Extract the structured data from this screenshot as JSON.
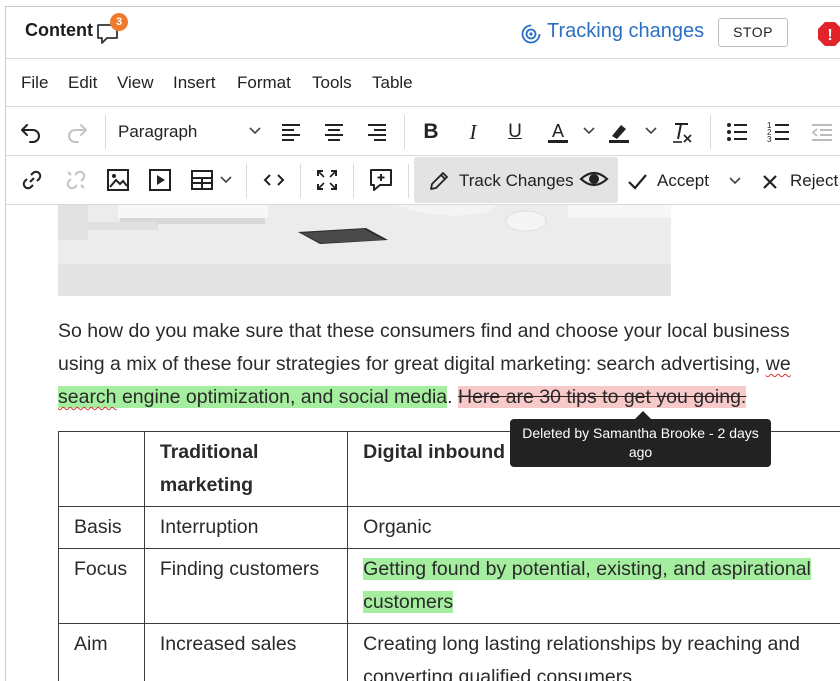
{
  "header": {
    "title": "Content",
    "comment_count": "3",
    "tracking_label": "Tracking changes",
    "stop_label": "STOP",
    "alert_glyph": "!"
  },
  "menu": [
    "File",
    "Edit",
    "View",
    "Insert",
    "Format",
    "Tools",
    "Table"
  ],
  "toolbar": {
    "paragraph_label": "Paragraph",
    "track_changes_label": "Track Changes",
    "accept_label": "Accept",
    "reject_label": "Reject"
  },
  "content": {
    "line1": "So how do you make sure that these consumers find and choose your local business",
    "line2_a": "using a mix of these four strategies for great digital marketing: search advertising, ",
    "line2_b": "we",
    "line3_ins_word": "search",
    "line3_ins_rest": " engine optimization, and social media",
    "line3_period": ". ",
    "line3_del": "Here are 30 tips to get you going.",
    "tooltip": "Deleted by Samantha Brooke - 2 days ago",
    "table": {
      "header": [
        "",
        "Traditional marketing",
        "Digital inbound marketing"
      ],
      "rows": [
        [
          "Basis",
          "Interruption",
          "Organic"
        ],
        [
          "Focus",
          "Finding customers",
          "Getting found by potential, existing, and aspirational customers"
        ],
        [
          "Aim",
          "Increased sales",
          "Creating long lasting relationships by reaching and converting qualified consumers"
        ]
      ]
    }
  },
  "colors": {
    "accent_blue": "#2b6fc4",
    "badge_orange": "#ef7a2e",
    "alert_red": "#e0242a",
    "insert_green": "#a5ee9f",
    "delete_pink": "#f8c9c9"
  }
}
